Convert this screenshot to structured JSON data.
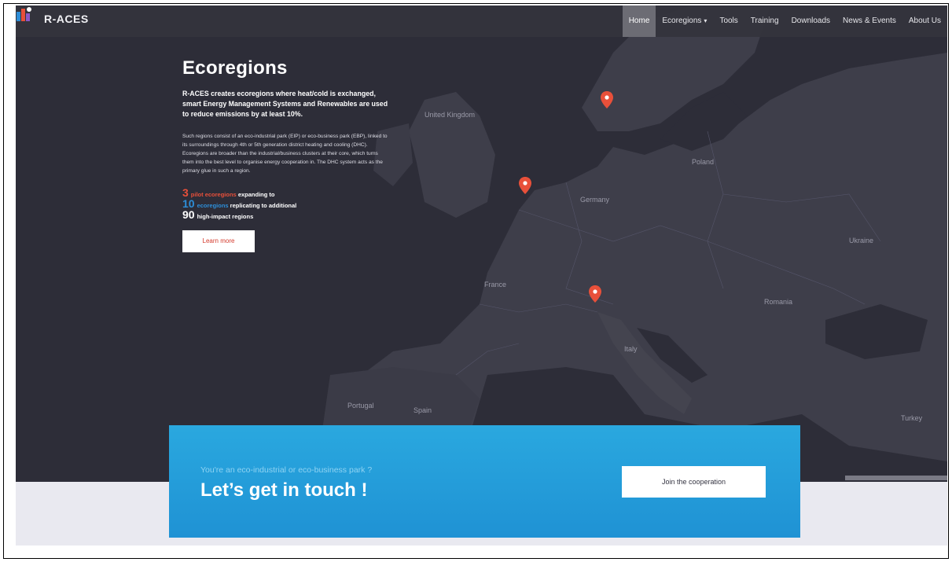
{
  "brand": {
    "name": "R-ACES"
  },
  "nav": {
    "items": [
      {
        "label": "Home",
        "active": true
      },
      {
        "label": "Ecoregions",
        "dropdown": true
      },
      {
        "label": "Tools"
      },
      {
        "label": "Training"
      },
      {
        "label": "Downloads"
      },
      {
        "label": "News & Events"
      },
      {
        "label": "About Us"
      }
    ],
    "chevron": "▾"
  },
  "hero": {
    "title": "Ecoregions",
    "lead": "R-ACES creates ecoregions where heat/cold is exchanged, smart Energy Management Systems and Renewables are used to reduce emissions by at least 10%.",
    "body": "Such regions consist of an eco-industrial park (EIP) or eco-business park (EBP), linked to its surroundings through 4th or 5th generation district heating and cooling (DHC). Ecoregions are broader than the industrial/business clusters at their core, which turns them into the best level to organise energy cooperation in. The DHC system acts as the primary glue in such a region.",
    "stats": [
      {
        "number": "3",
        "highlight": "pilot ecoregions",
        "rest": " expanding to"
      },
      {
        "number": "10",
        "highlight": "ecoregions",
        "rest": " replicating to additional"
      },
      {
        "number": "90",
        "highlight": "",
        "rest": "high-impact regions"
      }
    ],
    "learn_more": "Learn more"
  },
  "map": {
    "labels": [
      {
        "text": "United Kingdom"
      },
      {
        "text": "Germany"
      },
      {
        "text": "Poland"
      },
      {
        "text": "France"
      },
      {
        "text": "Ukraine"
      },
      {
        "text": "Romania"
      },
      {
        "text": "Italy"
      },
      {
        "text": "Spain"
      },
      {
        "text": "Portugal"
      },
      {
        "text": "Turkey"
      }
    ],
    "marker_color": "#e8503a"
  },
  "cta": {
    "subtitle": "You're an eco-industrial or eco-business park ?",
    "title": "Let’s get in touch !",
    "button": "Join the cooperation"
  },
  "colors": {
    "accent_red": "#e8503a",
    "accent_blue": "#2d8ed8",
    "map_bg": "#33333f",
    "cta_bg": "#2aa8df"
  }
}
